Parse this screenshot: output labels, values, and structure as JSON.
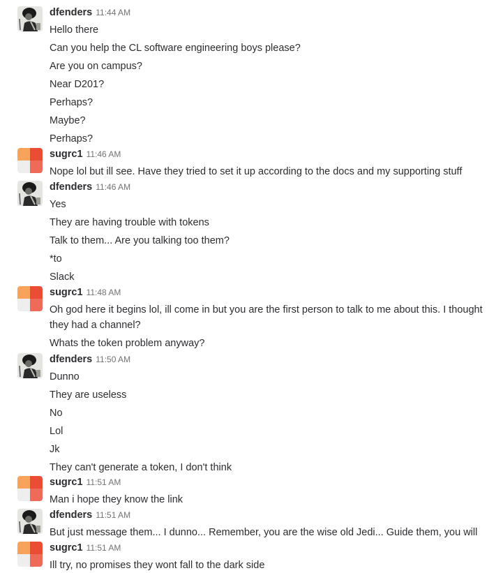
{
  "groups": [
    {
      "author": "dfenders",
      "time": "11:44 AM",
      "avatar": "dfenders-avatar",
      "lines": [
        "Hello there",
        "Can you help the CL software engineering boys please?",
        "Are you on campus?",
        "Near D201?",
        "Perhaps?",
        "Maybe?",
        "Perhaps?"
      ]
    },
    {
      "author": "sugrc1",
      "time": "11:46 AM",
      "avatar": "sugrc1-avatar",
      "lines": [
        "Nope lol but ill see. Have they tried to set it up according to the docs and my supporting stuff"
      ]
    },
    {
      "author": "dfenders",
      "time": "11:46 AM",
      "avatar": "dfenders-avatar",
      "lines": [
        "Yes",
        "They are having trouble with tokens",
        "Talk to them... Are you talking too them?",
        "*to",
        "Slack"
      ]
    },
    {
      "author": "sugrc1",
      "time": "11:48 AM",
      "avatar": "sugrc1-avatar",
      "lines": [
        "Oh god here it begins lol, ill come in but you are the first person to talk to me about this. I thought they had a channel?",
        "Whats the token problem anyway?"
      ]
    },
    {
      "author": "dfenders",
      "time": "11:50 AM",
      "avatar": "dfenders-avatar",
      "lines": [
        "Dunno",
        "They are useless",
        "No",
        "Lol",
        "Jk",
        "They can't generate a token, I don't think"
      ]
    },
    {
      "author": "sugrc1",
      "time": "11:51 AM",
      "avatar": "sugrc1-avatar",
      "lines": [
        "Man i hope they know the link"
      ]
    },
    {
      "author": "dfenders",
      "time": "11:51 AM",
      "avatar": "dfenders-avatar",
      "lines": [
        "But just message them... I dunno... Remember, you are the wise old Jedi... Guide them, you will"
      ]
    },
    {
      "author": "sugrc1",
      "time": "11:51 AM",
      "avatar": "sugrc1-avatar",
      "lines": [
        "Ill try, no promises they wont fall to the dark side"
      ]
    }
  ]
}
